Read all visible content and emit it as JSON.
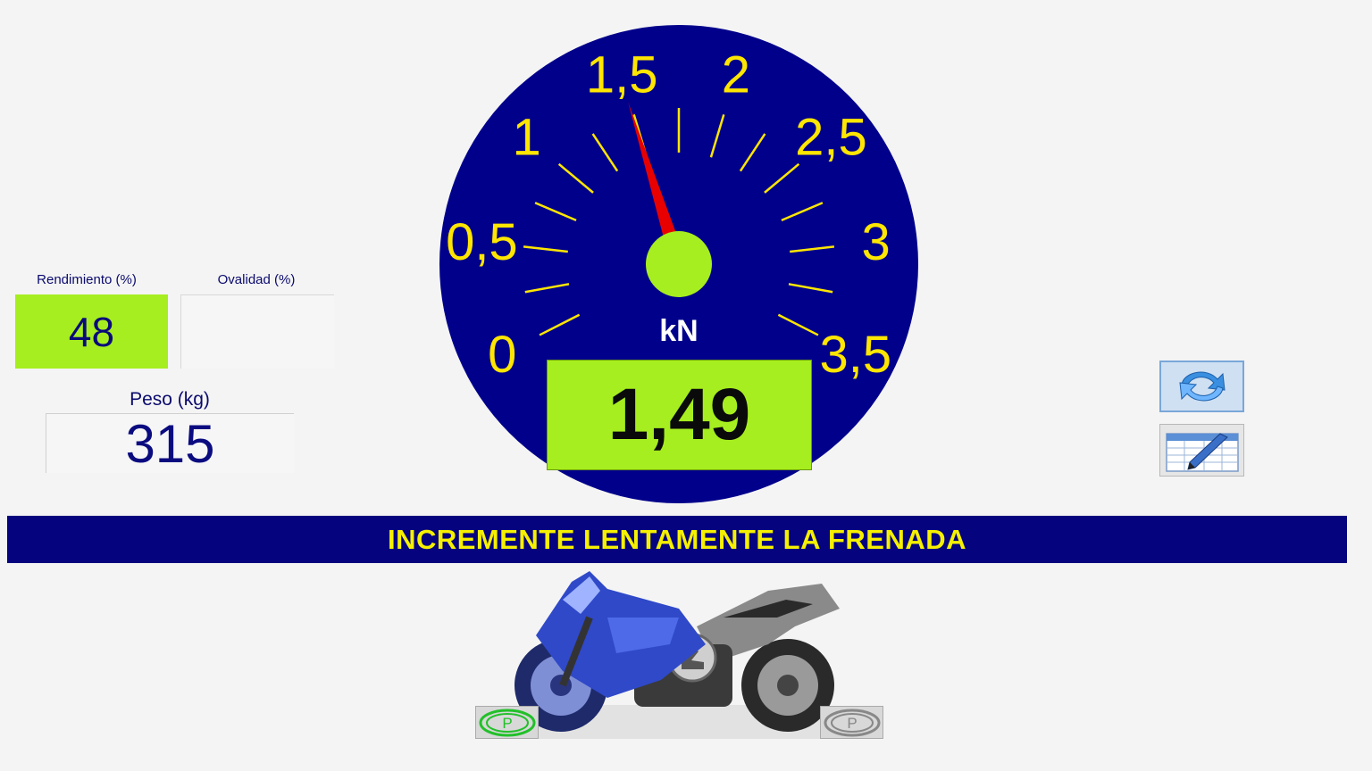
{
  "panels": {
    "rendimiento": {
      "label": "Rendimiento (%)",
      "value": "48"
    },
    "ovalidad": {
      "label": "Ovalidad (%)",
      "value": ""
    },
    "peso": {
      "label": "Peso (kg)",
      "value": "315"
    }
  },
  "gauge": {
    "unit": "kN",
    "reading": "1,49",
    "value": 1.49,
    "min": 0,
    "max": 3.5,
    "tick_labels": [
      "0",
      "0,5",
      "1",
      "1,5",
      "2",
      "2,5",
      "3",
      "3,5"
    ],
    "colors": {
      "dial": "#00008b",
      "tick": "#ffe600",
      "needle": "#e80000",
      "hub": "#a6ee1f"
    }
  },
  "banner": {
    "text": "INCREMENTE LENTAMENTE LA FRENADA"
  },
  "toolbar": {
    "refresh_icon": "refresh-icon",
    "edit_icon": "spreadsheet-pen-icon"
  },
  "parking": {
    "left_label": "P",
    "right_label": "P",
    "left_color": "#22c02a",
    "right_color": "#888888"
  }
}
